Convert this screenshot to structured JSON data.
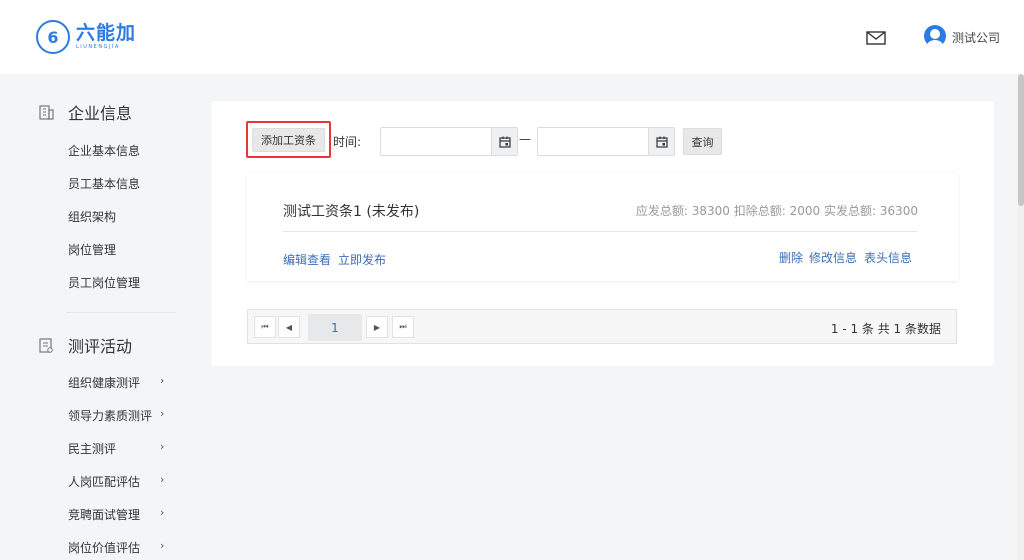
{
  "header": {
    "logo_mark": "6",
    "logo_name": "六能加",
    "logo_sub": "LIUNENGJIA",
    "company": "测试公司"
  },
  "sidebar": {
    "sections": [
      {
        "title": "企业信息",
        "icon": "building-icon"
      },
      {
        "title": "测评活动",
        "icon": "clipboard-icon"
      }
    ],
    "enterprise_items": [
      "企业基本信息",
      "员工基本信息",
      "组织架构",
      "岗位管理",
      "员工岗位管理"
    ],
    "evaluation_items": [
      "组织健康测评",
      "领导力素质测评",
      "民主测评",
      "人岗匹配评估",
      "竞聘面试管理",
      "岗位价值评估"
    ],
    "chevron": "›"
  },
  "toolbar": {
    "add_label": "添加工资条",
    "time_label": "时间:",
    "date_separator": "—",
    "query_label": "查询"
  },
  "payslip": {
    "title": "测试工资条1 (未发布)",
    "totals": "应发总额: 38300 扣除总额: 2000 实发总额: 36300",
    "edit_view": "编辑查看",
    "publish_now": "立即发布",
    "delete": "删除",
    "modify_info": "修改信息",
    "header_info": "表头信息"
  },
  "pagination": {
    "first": "⏮",
    "prev": "◀",
    "page": "1",
    "next": "▶",
    "last": "⏭",
    "info": "1 - 1 条   共 1 条数据"
  },
  "colors": {
    "accent": "#2c7be5",
    "link": "#3b6fb6",
    "highlight_border": "#e53935"
  }
}
